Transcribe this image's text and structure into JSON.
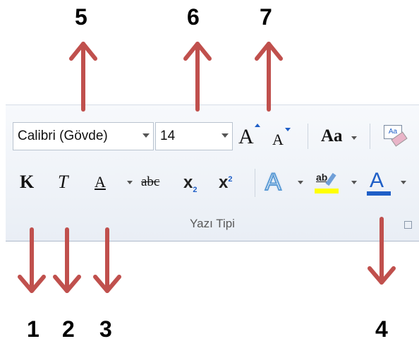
{
  "annotations": {
    "n1": "1",
    "n2": "2",
    "n3": "3",
    "n4": "4",
    "n5": "5",
    "n6": "6",
    "n7": "7",
    "arrow_color": "#c0504d"
  },
  "ribbon": {
    "group_label": "Yazı Tipi",
    "font_name": "Calibri (Gövde)",
    "font_size": "14",
    "grow_font": "A",
    "shrink_font": "A",
    "change_case": "Aa",
    "bold": "K",
    "italic": "T",
    "underline": "A",
    "strikethrough": "abc",
    "subscript": "x",
    "subscript_mark": "2",
    "superscript": "x",
    "superscript_mark": "2",
    "text_effects": "A",
    "highlight": "ab",
    "font_color": "A",
    "clear_formatting": "Aa",
    "colors": {
      "highlight": "#ffff00",
      "font_color": "#1f5fc7",
      "text_effects": "#5b9bd5"
    }
  }
}
